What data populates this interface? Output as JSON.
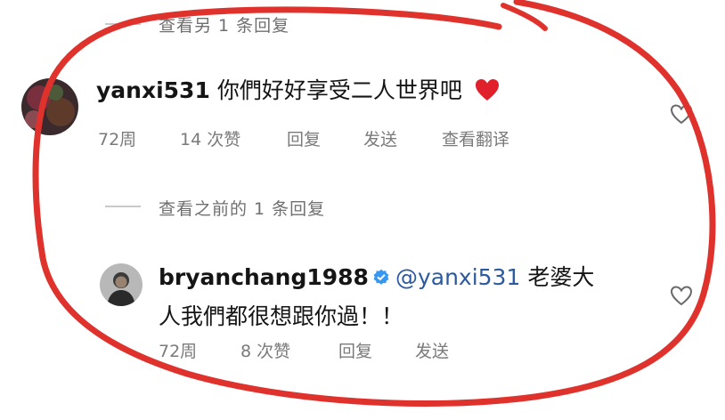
{
  "thread1": {
    "view_more": "查看另 1 条回复"
  },
  "comment1": {
    "username": "yanxi531",
    "text": "你們好好享受二人世界吧",
    "emoji": "heart-emoji",
    "time": "72周",
    "likes": "14 次赞",
    "reply": "回复",
    "send": "发送",
    "translate": "查看翻译"
  },
  "thread2": {
    "view_previous": "查看之前的 1 条回复"
  },
  "comment2": {
    "username": "bryanchang1988",
    "mention": "@yanxi531",
    "text_line1": "老婆大",
    "text_line2": "人我們都很想跟你過！！",
    "time": "72周",
    "likes": "8 次赞",
    "reply": "回复",
    "send": "发送"
  },
  "colors": {
    "annotation_red": "#e0322d",
    "mention_blue": "#2c5aa0",
    "verified_blue": "#3897f0",
    "heart_red": "#e0202a"
  }
}
